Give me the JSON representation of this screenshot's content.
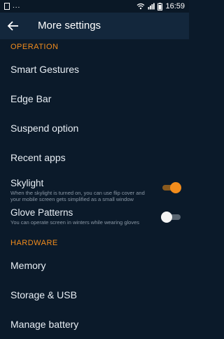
{
  "status": {
    "left_dots": "...",
    "time": "16:59"
  },
  "app_bar": {
    "title": "More settings"
  },
  "sections": {
    "operation": {
      "header": "OPERATION",
      "smart_gestures": "Smart Gestures",
      "edge_bar": "Edge Bar",
      "suspend_option": "Suspend option",
      "recent_apps": "Recent apps",
      "skylight": {
        "title": "Skylight",
        "desc": "When the skylight is turned on, you can use flip cover and your mobile screen gets simplified as a small window",
        "enabled": true
      },
      "glove_patterns": {
        "title": "Glove Patterns",
        "desc": "You can operate screen in winters while wearing gloves",
        "enabled": false
      }
    },
    "hardware": {
      "header": "HARDWARE",
      "memory": "Memory",
      "storage_usb": "Storage & USB",
      "manage_battery": "Manage battery"
    }
  },
  "colors": {
    "accent": "#f28c1c",
    "background": "#0b1a2a",
    "app_bar": "#13273c"
  }
}
